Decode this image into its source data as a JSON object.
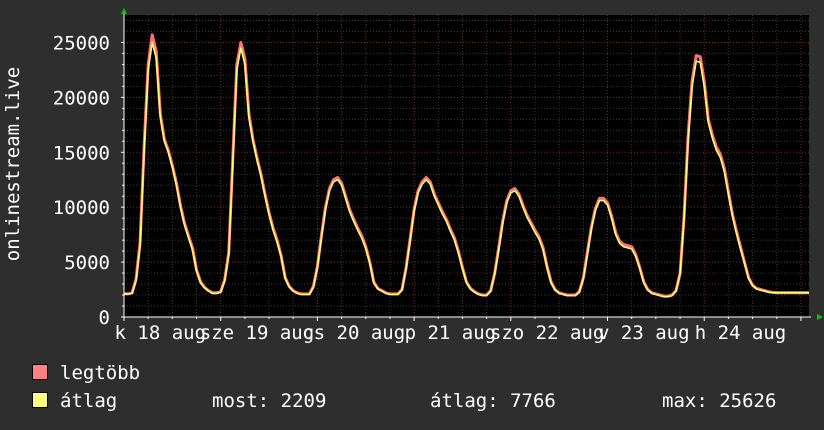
{
  "chart_data": {
    "type": "line",
    "ylabel": "onlinestream.live",
    "ylim": [
      0,
      27500
    ],
    "y_ticks": [
      0,
      5000,
      10000,
      15000,
      20000,
      25000
    ],
    "y_tick_labels": [
      "0",
      "5000",
      "10000",
      "15000",
      "20000",
      "25000"
    ],
    "x_labels": [
      "k 18 aug",
      "sze 19 aug",
      "cs 20 aug",
      "p 21 aug",
      "szo 22 aug",
      "v 23 aug",
      "h 24 aug"
    ],
    "grid": true,
    "legend_position": "bottom-left",
    "x_hours": [
      0,
      1,
      2,
      3,
      4,
      5,
      6,
      7,
      8,
      9,
      10,
      11,
      12,
      13,
      14,
      15,
      16,
      17,
      18,
      19,
      20,
      21,
      22,
      23,
      24,
      25,
      26,
      27,
      28,
      29,
      30,
      31,
      32,
      33,
      34,
      35,
      36,
      37,
      38,
      39,
      40,
      41,
      42,
      43,
      44,
      45,
      46,
      47,
      48,
      49,
      50,
      51,
      52,
      53,
      54,
      55,
      56,
      57,
      58,
      59,
      60,
      61,
      62,
      63,
      64,
      65,
      66,
      67,
      68,
      69,
      70,
      71,
      72,
      73,
      74,
      75,
      76,
      77,
      78,
      79,
      80,
      81,
      82,
      83,
      84,
      85,
      86,
      87,
      88,
      89,
      90,
      91,
      92,
      93,
      94,
      95,
      96,
      97,
      98,
      99,
      100,
      101,
      102,
      103,
      104,
      105,
      106,
      107,
      108,
      109,
      110,
      111,
      112,
      113,
      114,
      115,
      116,
      117,
      118,
      119,
      120,
      121,
      122,
      123,
      124,
      125,
      126,
      127,
      128,
      129,
      130,
      131,
      132,
      133,
      134,
      135,
      136,
      137,
      138,
      139,
      140,
      141,
      142,
      143,
      144,
      145,
      146,
      147,
      148,
      149,
      150,
      151,
      152,
      153,
      154,
      155,
      156,
      157,
      158,
      159,
      160,
      161,
      162,
      163,
      164,
      165,
      166,
      167,
      168,
      169,
      170
    ],
    "series": [
      {
        "name": "legtöbb",
        "color": "#ff7070",
        "values": [
          2100,
          2100,
          2200,
          3500,
          6800,
          15500,
          23000,
          25700,
          24200,
          18500,
          16200,
          15200,
          13800,
          12200,
          10200,
          8600,
          7400,
          6300,
          4300,
          3200,
          2700,
          2400,
          2200,
          2200,
          2300,
          3400,
          5900,
          14500,
          23000,
          25000,
          23500,
          18500,
          16200,
          14500,
          13000,
          11200,
          9500,
          8100,
          7000,
          5600,
          3600,
          2800,
          2400,
          2200,
          2100,
          2100,
          2100,
          2800,
          4600,
          7400,
          10000,
          11700,
          12500,
          12700,
          12200,
          11000,
          9800,
          8900,
          8100,
          7400,
          6400,
          5000,
          3200,
          2600,
          2400,
          2200,
          2100,
          2100,
          2100,
          2500,
          4500,
          7100,
          9800,
          11500,
          12300,
          12700,
          12300,
          11200,
          10400,
          9600,
          8900,
          8000,
          7200,
          6000,
          4500,
          3200,
          2600,
          2300,
          2100,
          2000,
          2000,
          2400,
          4000,
          6300,
          8800,
          10600,
          11500,
          11700,
          11200,
          10200,
          9300,
          8600,
          7900,
          7300,
          6300,
          4600,
          3200,
          2500,
          2200,
          2100,
          2000,
          2000,
          2000,
          2300,
          3600,
          5900,
          8200,
          9900,
          10800,
          10800,
          10400,
          9200,
          7700,
          6900,
          6600,
          6500,
          6400,
          5700,
          4500,
          3200,
          2500,
          2200,
          2100,
          2000,
          1900,
          1900,
          2000,
          2400,
          4000,
          9200,
          16500,
          21500,
          23800,
          23700,
          21500,
          18000,
          16600,
          15500,
          14800,
          13500,
          11400,
          9400,
          7800,
          6400,
          5000,
          3600,
          2900,
          2600,
          2500,
          2400,
          2300,
          2250,
          2209,
          2209,
          2209,
          2209,
          2209,
          2209,
          2209,
          2209,
          2209
        ]
      },
      {
        "name": "átlag",
        "color": "#ffff7a",
        "values": [
          2100,
          2100,
          2150,
          3300,
          6500,
          15000,
          22500,
          25000,
          23600,
          18200,
          16000,
          15000,
          13600,
          12000,
          10000,
          8400,
          7200,
          6100,
          4200,
          3100,
          2650,
          2350,
          2150,
          2150,
          2250,
          3300,
          5700,
          14000,
          22500,
          24500,
          23000,
          18200,
          16000,
          14300,
          12800,
          11000,
          9300,
          7900,
          6800,
          5500,
          3500,
          2750,
          2350,
          2150,
          2050,
          2050,
          2050,
          2700,
          4500,
          7200,
          9800,
          11500,
          12300,
          12500,
          12000,
          10800,
          9600,
          8700,
          7900,
          7200,
          6200,
          4900,
          3100,
          2550,
          2350,
          2150,
          2050,
          2050,
          2050,
          2450,
          4400,
          6900,
          9600,
          11300,
          12100,
          12500,
          12100,
          11000,
          10200,
          9400,
          8700,
          7800,
          7000,
          5800,
          4400,
          3100,
          2550,
          2250,
          2050,
          1950,
          1950,
          2350,
          3900,
          6100,
          8600,
          10400,
          11300,
          11500,
          11000,
          10000,
          9100,
          8400,
          7700,
          7100,
          6100,
          4500,
          3100,
          2450,
          2150,
          2050,
          1950,
          1950,
          1950,
          2250,
          3500,
          5700,
          8000,
          9700,
          10600,
          10600,
          10200,
          9000,
          7500,
          6700,
          6400,
          6300,
          6200,
          5500,
          4400,
          3100,
          2450,
          2150,
          2050,
          1950,
          1850,
          1850,
          1950,
          2350,
          3900,
          9000,
          16000,
          21000,
          23300,
          23200,
          21000,
          17700,
          16300,
          15200,
          14500,
          13200,
          11200,
          9200,
          7600,
          6200,
          4900,
          3500,
          2850,
          2550,
          2450,
          2350,
          2250,
          2200,
          2209,
          2209,
          2209,
          2209,
          2209,
          2209,
          2209,
          2209,
          2209
        ]
      }
    ]
  },
  "legend": {
    "max_label": "legtöbb",
    "avg_label": "átlag",
    "max_color": "#ff8080",
    "avg_color": "#ffff80"
  },
  "stats": {
    "now": "most: 2209",
    "avg": "átlag: 7766",
    "max": "max: 25626"
  },
  "colors": {
    "background": "#2e2e2e",
    "plot_background": "#000000",
    "grid_major": "#7a2a2a",
    "grid_minor": "#3a3a3a",
    "axis": "#ffffff",
    "arrow": "#00cc00"
  }
}
